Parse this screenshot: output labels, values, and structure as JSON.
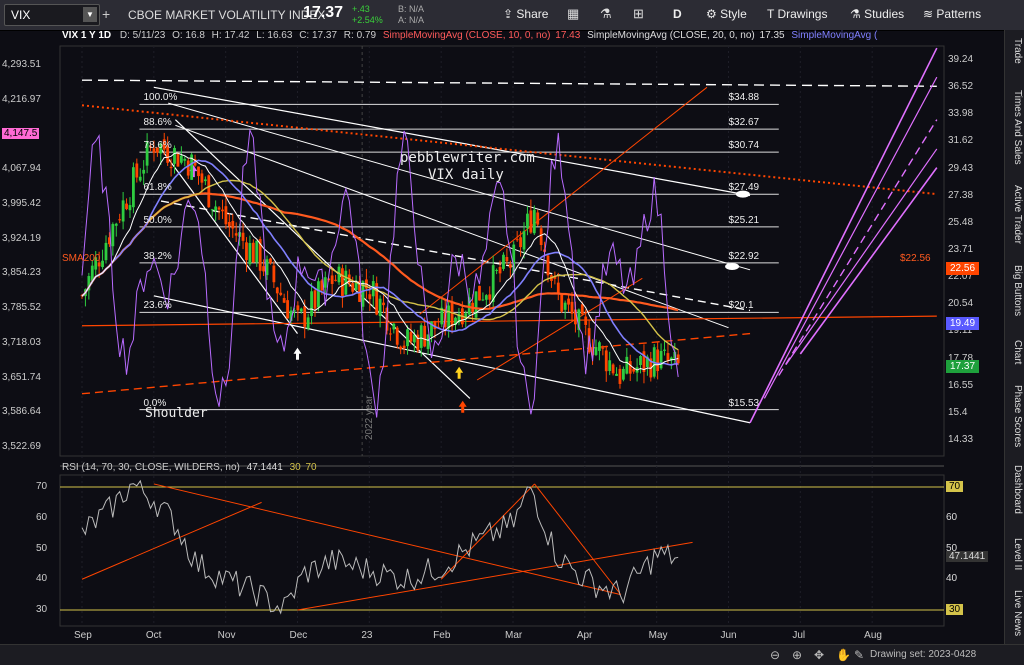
{
  "toolbar": {
    "symbol": "VIX",
    "description": "CBOE MARKET VOLATILITY INDEX",
    "last": "17.37",
    "change": "+.43",
    "change_pct": "+2.54%",
    "bid": "B: N/A",
    "ask": "A: N/A",
    "share": "Share",
    "interval": "D",
    "style": "Style",
    "drawings": "Drawings",
    "studies": "Studies",
    "patterns": "Patterns"
  },
  "sidebar": [
    "Trade",
    "Times And Sales",
    "Active Trader",
    "Big Buttons",
    "Chart",
    "Phase Scores",
    "Dashboard",
    "Level II",
    "Live News"
  ],
  "status": {
    "drawing_set": "Drawing set: 2023-0428"
  },
  "colors": {
    "up": "#2ecc40",
    "down": "#ff4500",
    "sma200": "#ff5a1f",
    "sma20": "#8080ff",
    "sma10": "#ffffff",
    "sma50": "#d4c34a",
    "purple": "#b86bff",
    "magenta": "#e070ff"
  },
  "chart_data": [
    {
      "type": "line",
      "panel": "price",
      "legend": {
        "header": "VIX 1 Y 1D",
        "date": "D: 5/11/23",
        "open": "O: 16.8",
        "high": "H: 17.42",
        "low": "L: 16.63",
        "close": "C: 17.37",
        "range": "R: 0.79",
        "sma10": "SimpleMovingAvg (CLOSE, 10, 0, no)",
        "sma10_val": "17.43",
        "sma20": "SimpleMovingAvg (CLOSE, 20, 0, no)",
        "sma20_val": "17.35",
        "sma20b": "SimpleMovingAvg ("
      },
      "x_tick_labels": [
        "Sep",
        "Oct",
        "Nov",
        "Dec",
        "23",
        "Feb",
        "Mar",
        "Apr",
        "May",
        "Jun",
        "Jul",
        "Aug"
      ],
      "x_tick_months": [
        0,
        1,
        2,
        3,
        4,
        5,
        6,
        7,
        8,
        9,
        10,
        11
      ],
      "left_axis": {
        "labels": [
          "4,293.51",
          "4,216.97",
          "4,147.5",
          "4,067.94",
          "3,995.42",
          "3,924.19",
          "3,854.23",
          "3,785.52",
          "3,718.03",
          "3,651.74",
          "3,586.64",
          "3,522.69"
        ],
        "values": [
          4293.51,
          4216.97,
          4147.5,
          4067.94,
          3995.42,
          3924.19,
          3854.23,
          3785.52,
          3718.03,
          3651.74,
          3586.64,
          3522.69
        ],
        "highlight": "4,147.5"
      },
      "right_axis": {
        "labels": [
          "39.24",
          "36.52",
          "33.98",
          "31.62",
          "29.43",
          "27.38",
          "25.48",
          "23.71",
          "22.07",
          "20.54",
          "19.11",
          "17.78",
          "16.55",
          "15.4",
          "14.33"
        ],
        "values": [
          39.24,
          36.52,
          33.98,
          31.62,
          29.43,
          27.38,
          25.48,
          23.71,
          22.07,
          20.54,
          19.11,
          17.78,
          16.55,
          15.4,
          14.33
        ],
        "scale": "log",
        "badges": [
          {
            "label": "22.56",
            "value": 22.56,
            "color": "#ff4500"
          },
          {
            "label": "19.49",
            "value": 19.49,
            "color": "#5a5aff"
          },
          {
            "label": "17.37",
            "value": 17.37,
            "color": "#1ea03c"
          }
        ]
      },
      "fib_levels": [
        {
          "pct": "100.0%",
          "price": "$34.88",
          "value": 34.88
        },
        {
          "pct": "88.6%",
          "price": "$32.67",
          "value": 32.67
        },
        {
          "pct": "78.6%",
          "price": "$30.74",
          "value": 30.74
        },
        {
          "pct": "61.8%",
          "price": "$27.49",
          "value": 27.49
        },
        {
          "pct": "50.0%",
          "price": "$25.21",
          "value": 25.21
        },
        {
          "pct": "38.2%",
          "price": "$22.92",
          "value": 22.92
        },
        {
          "pct": "23.6%",
          "price": "$20.1",
          "value": 20.1
        },
        {
          "pct": "0.0%",
          "price": "$15.53",
          "value": 15.53
        }
      ],
      "annotations": {
        "watermark": "pebblewriter.com",
        "subtitle": "VIX daily",
        "shoulder": "Shoulder",
        "year": "2022 year",
        "sma200": "SMA200",
        "sma200_price": "$22.56"
      },
      "candles_close_monthly": [
        {
          "month": 0.0,
          "close": 21.0
        },
        {
          "month": 0.5,
          "close": 26.0
        },
        {
          "month": 1.0,
          "close": 31.5
        },
        {
          "month": 1.5,
          "close": 30.0
        },
        {
          "month": 2.0,
          "close": 25.5
        },
        {
          "month": 2.5,
          "close": 23.0
        },
        {
          "month": 3.0,
          "close": 19.5
        },
        {
          "month": 3.5,
          "close": 22.0
        },
        {
          "month": 4.0,
          "close": 21.5
        },
        {
          "month": 4.5,
          "close": 18.5
        },
        {
          "month": 5.0,
          "close": 19.5
        },
        {
          "month": 5.5,
          "close": 21.0
        },
        {
          "month": 6.0,
          "close": 23.0
        },
        {
          "month": 6.3,
          "close": 26.5
        },
        {
          "month": 6.6,
          "close": 21.0
        },
        {
          "month": 7.0,
          "close": 19.0
        },
        {
          "month": 7.5,
          "close": 17.0
        },
        {
          "month": 8.0,
          "close": 17.8
        },
        {
          "month": 8.3,
          "close": 17.37
        }
      ]
    },
    {
      "type": "line",
      "panel": "rsi",
      "legend": {
        "text": "RSI (14, 70, 30, CLOSE, WILDERS, no)",
        "value": "47.1441",
        "ob": "30",
        "os": "70"
      },
      "y_labels": [
        "70",
        "60",
        "50",
        "40",
        "30"
      ],
      "y_values": [
        70,
        60,
        50,
        40,
        30
      ],
      "right_labels": [
        "70",
        "60",
        "50",
        "47.1441",
        "40",
        "30"
      ],
      "right_values": [
        70,
        60,
        50,
        47.1441,
        40,
        30
      ],
      "overbought": 70,
      "oversold": 30,
      "current": 47.1441,
      "series": [
        {
          "month": 0.0,
          "rsi": 55
        },
        {
          "month": 0.4,
          "rsi": 63
        },
        {
          "month": 0.7,
          "rsi": 71
        },
        {
          "month": 1.0,
          "rsi": 66
        },
        {
          "month": 1.3,
          "rsi": 58
        },
        {
          "month": 1.6,
          "rsi": 45
        },
        {
          "month": 2.0,
          "rsi": 40
        },
        {
          "month": 2.4,
          "rsi": 36
        },
        {
          "month": 2.8,
          "rsi": 30
        },
        {
          "month": 3.1,
          "rsi": 42
        },
        {
          "month": 3.5,
          "rsi": 46
        },
        {
          "month": 4.0,
          "rsi": 43
        },
        {
          "month": 4.5,
          "rsi": 40
        },
        {
          "month": 5.0,
          "rsi": 44
        },
        {
          "month": 5.5,
          "rsi": 52
        },
        {
          "month": 6.0,
          "rsi": 58
        },
        {
          "month": 6.25,
          "rsi": 70
        },
        {
          "month": 6.6,
          "rsi": 48
        },
        {
          "month": 7.0,
          "rsi": 40
        },
        {
          "month": 7.5,
          "rsi": 35
        },
        {
          "month": 8.0,
          "rsi": 48
        },
        {
          "month": 8.3,
          "rsi": 47.1441
        }
      ]
    }
  ]
}
